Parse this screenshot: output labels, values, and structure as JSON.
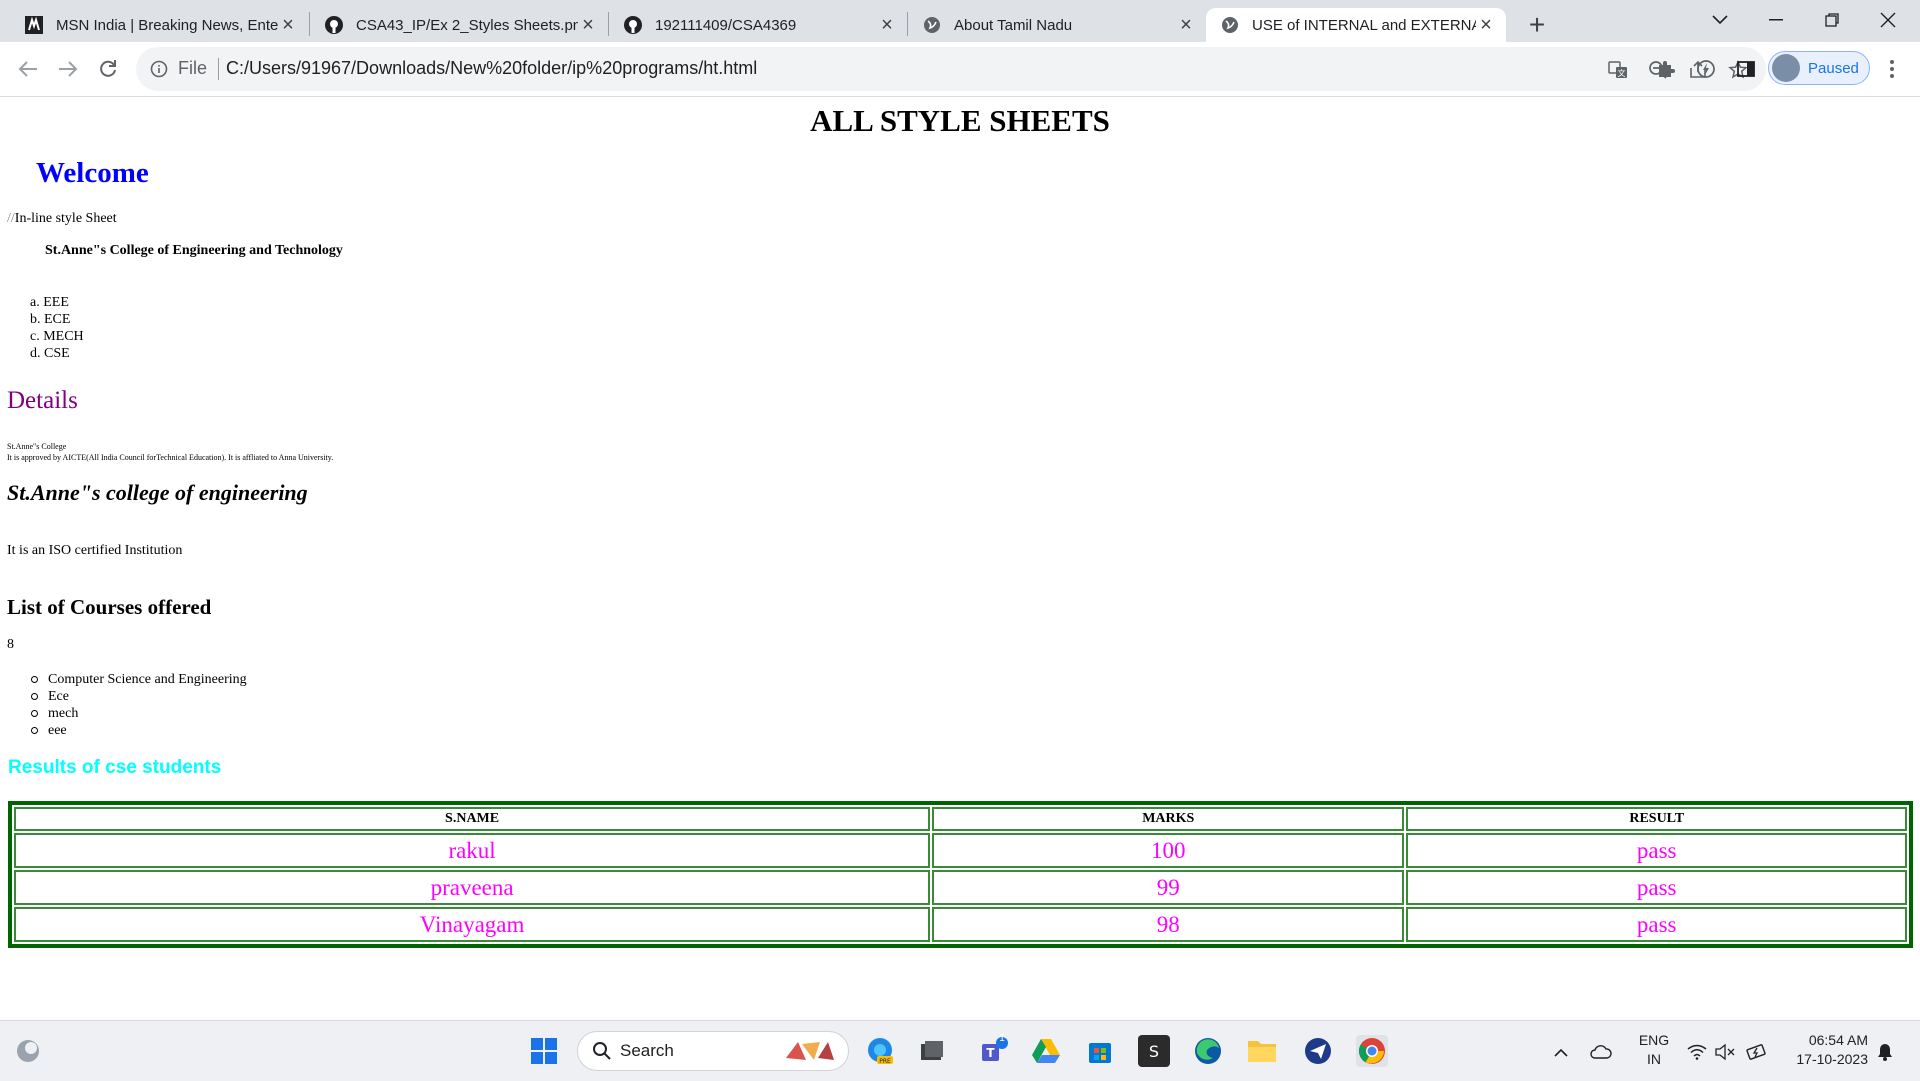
{
  "browser": {
    "tabs": [
      {
        "title": "MSN India | Breaking News, Ente",
        "icon": "msn-icon"
      },
      {
        "title": "CSA43_IP/Ex 2_Styles Sheets.pn",
        "icon": "github-icon"
      },
      {
        "title": "192111409/CSA4369",
        "icon": "github-icon"
      },
      {
        "title": "About Tamil Nadu",
        "icon": "globe-icon"
      },
      {
        "title": "USE of INTERNAL and EXTERNA",
        "icon": "globe-icon",
        "active": true
      }
    ],
    "address": {
      "scheme_label": "File",
      "url": "C:/Users/91967/Downloads/New%20folder/ip%20programs/ht.html"
    },
    "profile_label": "Paused"
  },
  "page": {
    "heading": "ALL STYLE SHEETS",
    "welcome": "Welcome",
    "inline_note_prefix": "//",
    "inline_note": "In-line style Sheet",
    "college_name": "St.Anne\"s College of Engineering and Technology",
    "ordered_list": [
      {
        "marker": "a.",
        "text": "EEE"
      },
      {
        "marker": "b.",
        "text": "ECE"
      },
      {
        "marker": "c.",
        "text": "MECH"
      },
      {
        "marker": "d.",
        "text": "CSE"
      }
    ],
    "details_heading": "Details",
    "tiny_line1": "St.Anne\"s College",
    "tiny_line2": "It is approved by AICTE(All India Council forTechnical Education). It is affliated to Anna University.",
    "italic_heading": "St.Anne\"s college of engineering",
    "iso_text": "It is an ISO certified Institution",
    "courses_heading": "List of Courses offered",
    "stray_char": "8",
    "courses": [
      "Computer Science and Engineering",
      "Ece",
      "mech",
      "eee"
    ],
    "results_heading": "Results of cse students",
    "table": {
      "headers": [
        "S.NAME",
        "MARKS",
        "RESULT"
      ],
      "rows": [
        [
          "rakul",
          "100",
          "pass"
        ],
        [
          "praveena",
          "99",
          "pass"
        ],
        [
          "Vinayagam",
          "98",
          "pass"
        ]
      ]
    },
    "colors": {
      "welcome": "#0000ff",
      "details": "#800080",
      "results_heading": "#00ffff",
      "table_cells": "#ff00ff",
      "table_border": "#006400"
    }
  },
  "taskbar": {
    "search_label": "Search",
    "language": "ENG",
    "region": "IN",
    "time": "06:54 AM",
    "date": "17-10-2023",
    "teams_badge": "1",
    "app_letter_s": "S"
  }
}
